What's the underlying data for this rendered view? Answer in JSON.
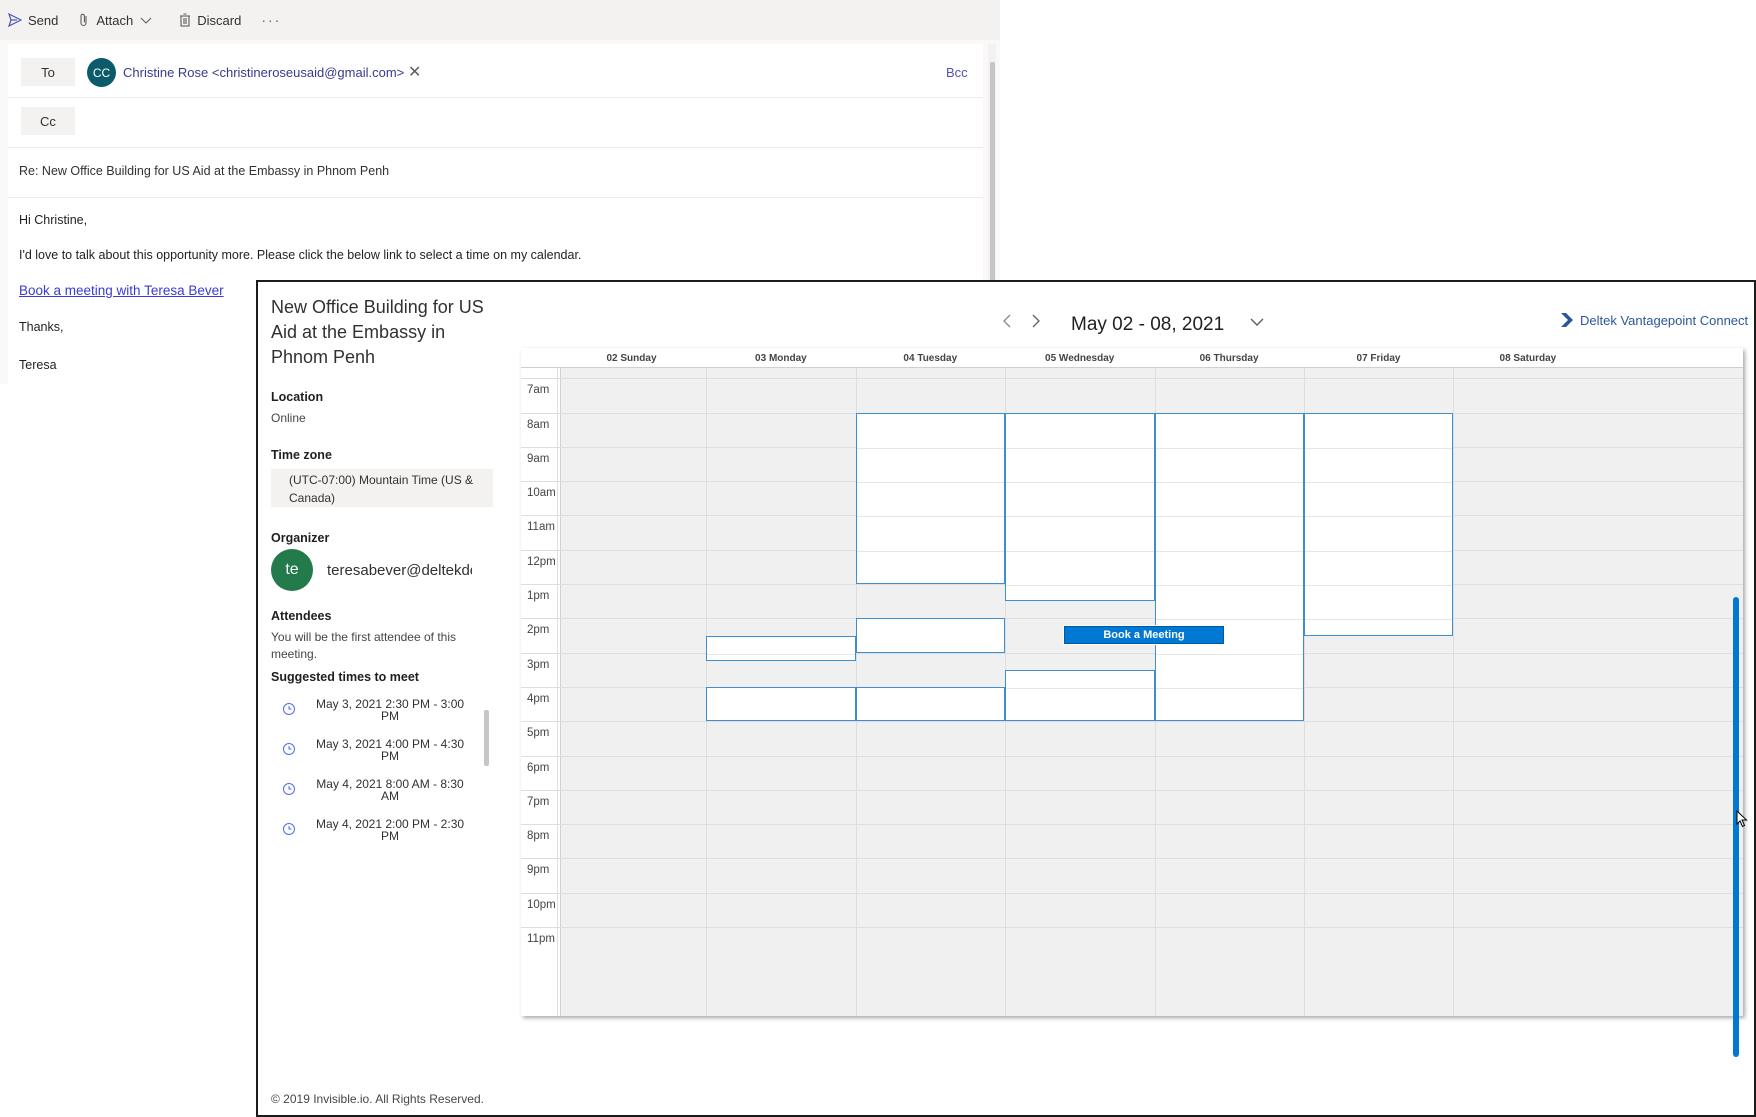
{
  "email": {
    "toolbar": {
      "send": "Send",
      "attach": "Attach",
      "discard": "Discard",
      "more": "···"
    },
    "to_label": "To",
    "cc_label": "Cc",
    "bcc_label": "Bcc",
    "recipient": {
      "initials": "CC",
      "display": "Christine Rose <christineroseusaid@gmail.com>"
    },
    "subject": "Re: New Office Building for US Aid at the Embassy in Phnom Penh",
    "body": {
      "greeting": "Hi Christine,",
      "line1": "I'd love to talk about this opportunity more. Please click the below link to select a time on my calendar.",
      "link": "Book a meeting with Teresa Bever",
      "thanks": "Thanks,",
      "signature": "Teresa"
    }
  },
  "booking": {
    "title": "New Office Building for US Aid at the Embassy in Phnom Penh",
    "week_range": "May 02 - 08, 2021",
    "brand": "Deltek Vantagepoint Connect",
    "location_label": "Location",
    "location_value": "Online",
    "timezone_label": "Time zone",
    "timezone_value": "(UTC-07:00) Mountain Time (US & Canada)",
    "organizer_label": "Organizer",
    "organizer_initials": "te",
    "organizer_email": "teresabever@deltekdemo.com",
    "attendees_label": "Attendees",
    "attendees_text": "You will be the first attendee of this meeting.",
    "suggested_label": "Suggested times to meet",
    "suggested": [
      "May 3, 2021 2:30 PM - 3:00 PM",
      "May 3, 2021 4:00 PM - 4:30 PM",
      "May 4, 2021 8:00 AM - 8:30 AM",
      "May 4, 2021 2:00 PM - 2:30 PM"
    ],
    "copyright": "© 2019 Invisible.io. All Rights Reserved.",
    "book_button": "Book a Meeting",
    "days": [
      "02 Sunday",
      "03 Monday",
      "04 Tuesday",
      "05 Wednesday",
      "06 Thursday",
      "07 Friday",
      "08 Saturday"
    ],
    "hours": [
      "7am",
      "8am",
      "9am",
      "10am",
      "11am",
      "12pm",
      "1pm",
      "2pm",
      "3pm",
      "4pm",
      "5pm",
      "6pm",
      "7pm",
      "8pm",
      "9pm",
      "10pm",
      "11pm"
    ],
    "available_slots": [
      {
        "day": 1,
        "start": 14.5,
        "end": 15.25
      },
      {
        "day": 1,
        "start": 16,
        "end": 17
      },
      {
        "day": 2,
        "start": 8,
        "end": 13
      },
      {
        "day": 2,
        "start": 14,
        "end": 15
      },
      {
        "day": 2,
        "start": 16,
        "end": 17
      },
      {
        "day": 3,
        "start": 8,
        "end": 13.5
      },
      {
        "day": 3,
        "start": 15.5,
        "end": 17
      },
      {
        "day": 4,
        "start": 8,
        "end": 17
      },
      {
        "day": 5,
        "start": 8,
        "end": 14.5
      }
    ]
  }
}
